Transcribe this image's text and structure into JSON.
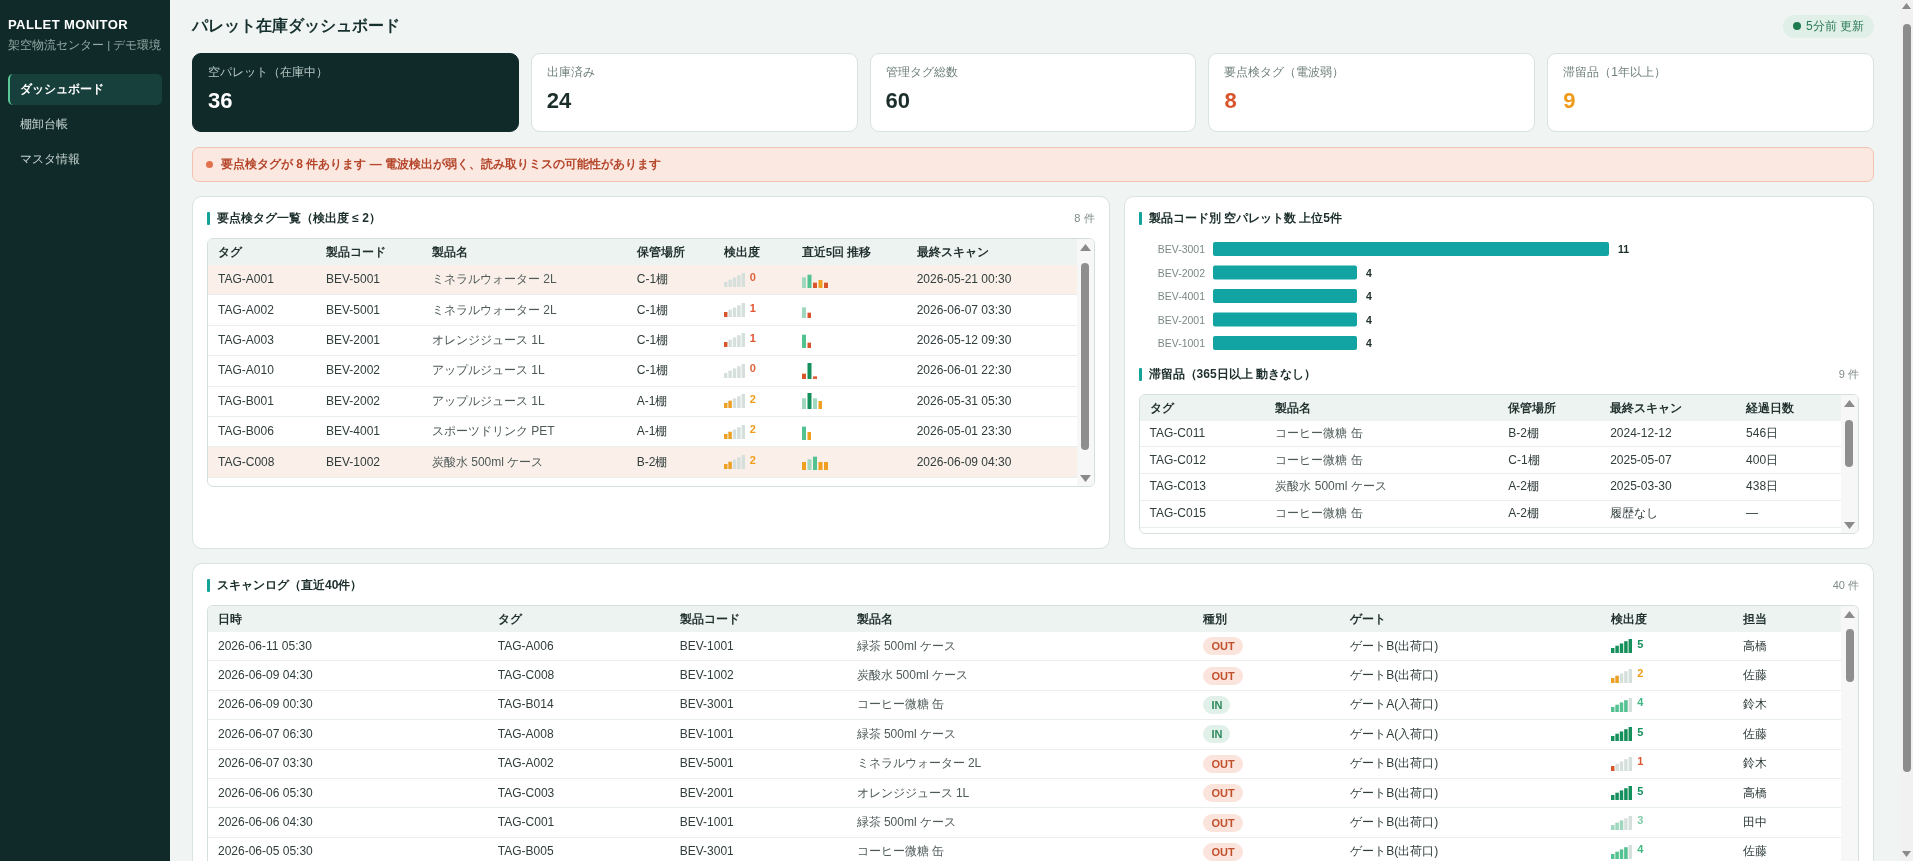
{
  "sidebar": {
    "title": "PALLET MONITOR",
    "subtitle": "架空物流センター | デモ環境",
    "items": [
      {
        "label": "ダッシュボード",
        "selected": true
      },
      {
        "label": "棚卸台帳",
        "selected": false
      },
      {
        "label": "マスタ情報",
        "selected": false
      }
    ]
  },
  "header": {
    "title": "パレット在庫ダッシュボード",
    "status": "5分前 更新"
  },
  "kpis": [
    {
      "label": "空パレット（在庫中）",
      "value": "36",
      "kind": "dark"
    },
    {
      "label": "出庫済み",
      "value": "24",
      "kind": "plain"
    },
    {
      "label": "管理タグ総数",
      "value": "60",
      "kind": "plain"
    },
    {
      "label": "要点検タグ（電波弱）",
      "value": "8",
      "kind": "danger"
    },
    {
      "label": "滞留品（1年以上）",
      "value": "9",
      "kind": "warning"
    }
  ],
  "alert": {
    "text": "要点検タグが 8 件あります — 電波検出が弱く、読み取りミスの可能性があります"
  },
  "weak_tags": {
    "title": "要点検タグ一覧（検出度 ≤ 2）",
    "count": "8 件",
    "columns": [
      "タグ",
      "製品コード",
      "製品名",
      "保管場所",
      "検出度",
      "直近5回 推移",
      "最終スキャン"
    ],
    "rows": [
      {
        "tag": "TAG-A001",
        "code": "BEV-5001",
        "name": "ミネラルウォーター 2L",
        "location": "C-1棚",
        "level": 0,
        "reading": "0",
        "last_scan": "2026-05-21 00:30",
        "highlighted": true
      },
      {
        "tag": "TAG-A002",
        "code": "BEV-5001",
        "name": "ミネラルウォーター 2L",
        "location": "C-1棚",
        "level": 0.2,
        "reading": "1",
        "last_scan": "2026-06-07 03:30",
        "highlighted": false
      },
      {
        "tag": "TAG-A003",
        "code": "BEV-2001",
        "name": "オレンジジュース 1L",
        "location": "C-1棚",
        "level": 0.2,
        "reading": "1",
        "last_scan": "2026-05-12 09:30",
        "highlighted": false
      },
      {
        "tag": "TAG-A010",
        "code": "BEV-2002",
        "name": "アップルジュース 1L",
        "location": "C-1棚",
        "level": 0,
        "reading": "0",
        "last_scan": "2026-06-01 22:30",
        "highlighted": false
      },
      {
        "tag": "TAG-B001",
        "code": "BEV-2002",
        "name": "アップルジュース 1L",
        "location": "A-1棚",
        "level": 0.4,
        "reading": "2",
        "last_scan": "2026-05-31 05:30",
        "highlighted": false
      },
      {
        "tag": "TAG-B006",
        "code": "BEV-4001",
        "name": "スポーツドリンク PET",
        "location": "A-1棚",
        "level": 0.4,
        "reading": "2",
        "last_scan": "2026-05-01 23:30",
        "highlighted": false
      },
      {
        "tag": "TAG-C008",
        "code": "BEV-1002",
        "name": "炭酸水 500ml ケース",
        "location": "B-2棚",
        "level": 0.4,
        "reading": "2",
        "last_scan": "2026-06-09 04:30",
        "highlighted": true
      }
    ]
  },
  "top_products": {
    "chart_data": {
      "type": "bar",
      "orientation": "horizontal",
      "title": "製品コード別 空パレット数 上位5件",
      "categories": [
        "BEV-3001",
        "BEV-2002",
        "BEV-4001",
        "BEV-2001",
        "BEV-1001"
      ],
      "values": [
        11,
        4,
        4,
        4,
        4
      ],
      "data_labels": true
    }
  },
  "stagnant": {
    "title": "滞留品（365日以上 動きなし）",
    "count": "9 件",
    "columns": [
      "タグ",
      "製品名",
      "保管場所",
      "最終スキャン",
      "経過日数"
    ],
    "rows": [
      {
        "tag": "TAG-C011",
        "name": "コーヒー微糖 缶",
        "location": "B-2棚",
        "last_scan": "2024-12-12",
        "days": "546日"
      },
      {
        "tag": "TAG-C012",
        "name": "コーヒー微糖 缶",
        "location": "C-1棚",
        "last_scan": "2025-05-07",
        "days": "400日"
      },
      {
        "tag": "TAG-C013",
        "name": "炭酸水 500ml ケース",
        "location": "A-2棚",
        "last_scan": "2025-03-30",
        "days": "438日"
      },
      {
        "tag": "TAG-C015",
        "name": "コーヒー微糖 缶",
        "location": "A-2棚",
        "last_scan": "履歴なし",
        "days": "—"
      }
    ]
  },
  "scan_log": {
    "title": "スキャンログ（直近40件）",
    "count": "40 件",
    "columns": [
      "日時",
      "タグ",
      "製品コード",
      "製品名",
      "種別",
      "ゲート",
      "検出度",
      "担当"
    ],
    "rows": [
      {
        "time": "2026-06-11 05:30",
        "tag": "TAG-A006",
        "code": "BEV-1001",
        "name": "緑茶 500ml ケース",
        "kind": "out",
        "direction": "OUT",
        "gate": "ゲートB(出荷口)",
        "level": 1,
        "reading": "5",
        "operator": "高橋"
      },
      {
        "time": "2026-06-09 04:30",
        "tag": "TAG-C008",
        "code": "BEV-1002",
        "name": "炭酸水 500ml ケース",
        "kind": "out",
        "direction": "OUT",
        "gate": "ゲートB(出荷口)",
        "level": 0.4,
        "reading": "2",
        "operator": "佐藤"
      },
      {
        "time": "2026-06-09 00:30",
        "tag": "TAG-B014",
        "code": "BEV-3001",
        "name": "コーヒー微糖 缶",
        "kind": "in",
        "direction": "IN",
        "gate": "ゲートA(入荷口)",
        "level": 0.8,
        "reading": "4",
        "operator": "鈴木"
      },
      {
        "time": "2026-06-07 06:30",
        "tag": "TAG-A008",
        "code": "BEV-1001",
        "name": "緑茶 500ml ケース",
        "kind": "in",
        "direction": "IN",
        "gate": "ゲートA(入荷口)",
        "level": 1,
        "reading": "5",
        "operator": "佐藤"
      },
      {
        "time": "2026-06-07 03:30",
        "tag": "TAG-A002",
        "code": "BEV-5001",
        "name": "ミネラルウォーター 2L",
        "kind": "out",
        "direction": "OUT",
        "gate": "ゲートB(出荷口)",
        "level": 0.2,
        "reading": "1",
        "operator": "鈴木"
      },
      {
        "time": "2026-06-06 05:30",
        "tag": "TAG-C003",
        "code": "BEV-2001",
        "name": "オレンジジュース 1L",
        "kind": "out",
        "direction": "OUT",
        "gate": "ゲートB(出荷口)",
        "level": 1,
        "reading": "5",
        "operator": "高橋"
      },
      {
        "time": "2026-06-06 04:30",
        "tag": "TAG-C001",
        "code": "BEV-1001",
        "name": "緑茶 500ml ケース",
        "kind": "out",
        "direction": "OUT",
        "gate": "ゲートB(出荷口)",
        "level": 0.6,
        "reading": "3",
        "operator": "田中"
      },
      {
        "time": "2026-06-05 05:30",
        "tag": "TAG-B005",
        "code": "BEV-3001",
        "name": "コーヒー微糖 缶",
        "kind": "out",
        "direction": "OUT",
        "gate": "ゲートB(出荷口)",
        "level": 0.8,
        "reading": "4",
        "operator": "佐藤"
      }
    ]
  }
}
